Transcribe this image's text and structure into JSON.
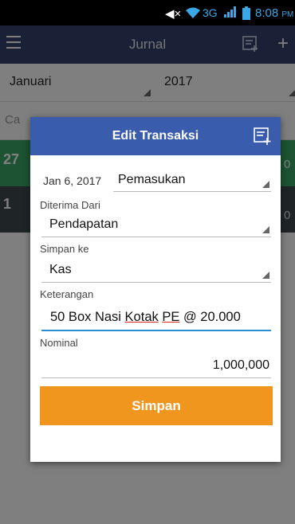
{
  "status_bar": {
    "network": "3G",
    "time": "8:08",
    "ampm": "PM"
  },
  "appbar": {
    "title": "Jurnal",
    "add_label": "+"
  },
  "filters": {
    "month": "Januari",
    "year": "2017"
  },
  "background": {
    "search_text": "Ca",
    "row1_day": "27",
    "row2_day": "1",
    "row_suffix": "0",
    "row_suffix2": "0"
  },
  "dialog": {
    "title": "Edit Transaksi",
    "date": "Jan 6, 2017",
    "type": "Pemasukan",
    "from_label": "Diterima Dari",
    "from_value": "Pendapatan",
    "store_label": "Simpan ke",
    "store_value": "Kas",
    "desc_label": "Keterangan",
    "desc_parts": [
      "50 Box Nasi ",
      "Kotak",
      " ",
      "PE",
      " @ 20.000"
    ],
    "nominal_label": "Nominal",
    "nominal_value": "1,000,000",
    "save_label": "Simpan"
  },
  "colors": {
    "appbar": "#34436e",
    "dialog_header": "#3a5cad",
    "save_button": "#f0961e",
    "accent": "#2a8fd0"
  }
}
